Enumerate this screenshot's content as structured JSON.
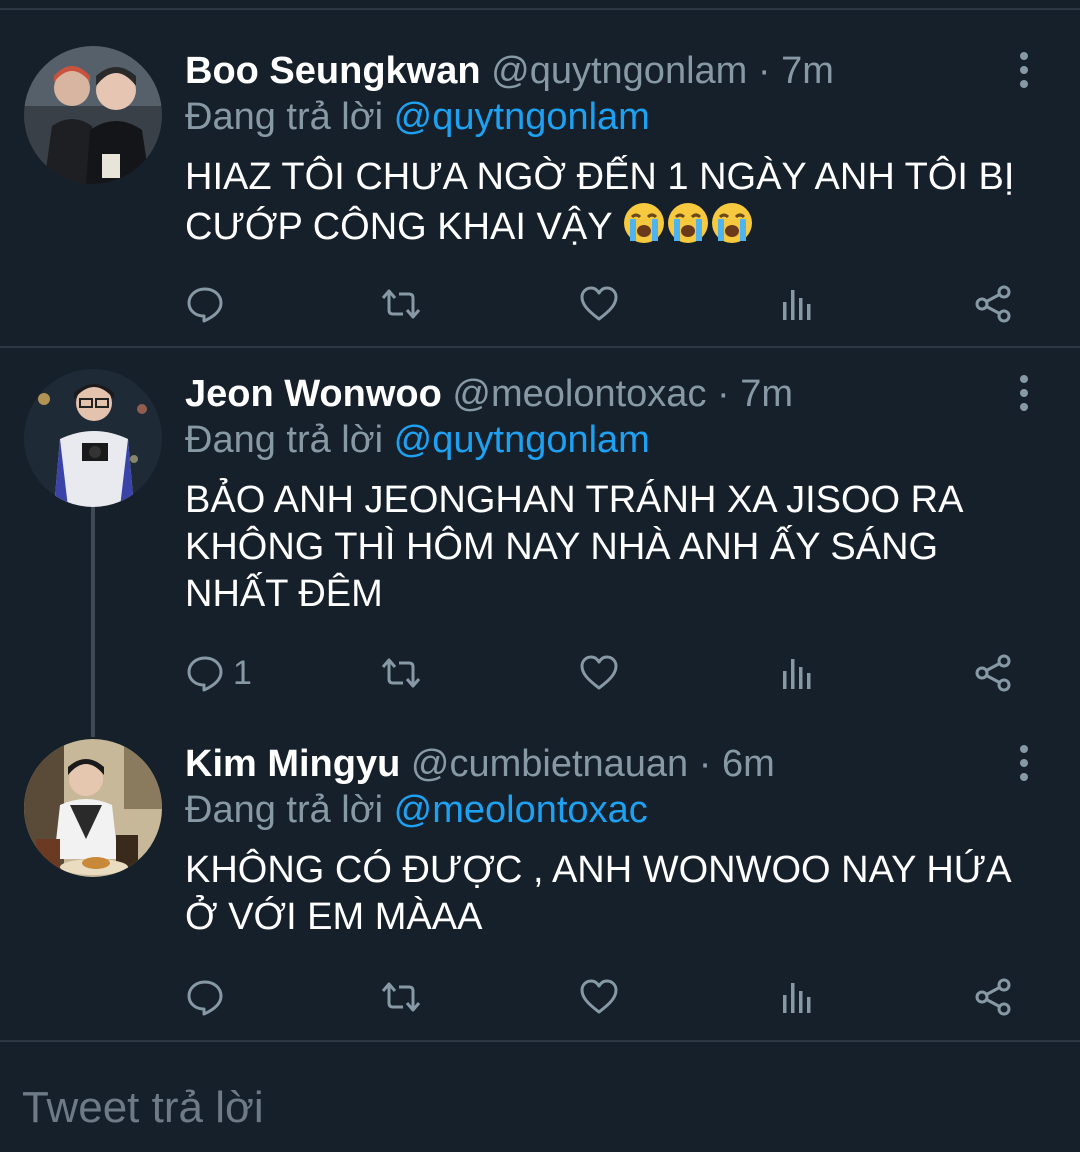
{
  "tweets": [
    {
      "name": "Boo Seungkwan",
      "handle": "@quytngonlam",
      "sep": "·",
      "time": "7m",
      "replying_label": "Đang trả lời",
      "replying_to": "@quytngonlam",
      "text": "HIAZ TÔI CHƯA NGỜ ĐẾN 1 NGÀY ANH TÔI BỊ CƯỚP CÔNG KHAI VẬY",
      "emojis": [
        "crying-face",
        "crying-face",
        "crying-face"
      ],
      "reply_count": ""
    },
    {
      "name": "Jeon Wonwoo",
      "handle": "@meolontoxac",
      "sep": "·",
      "time": "7m",
      "replying_label": "Đang trả lời",
      "replying_to": "@quytngonlam",
      "text": "BẢO ANH JEONGHAN TRÁNH XA JISOO RA KHÔNG THÌ HÔM NAY NHÀ ANH ẤY SÁNG NHẤT ĐÊM",
      "reply_count": "1"
    },
    {
      "name": "Kim Mingyu",
      "handle": "@cumbietnauan",
      "sep": "·",
      "time": "6m",
      "replying_label": "Đang trả lời",
      "replying_to": "@meolontoxac",
      "text": "KHÔNG CÓ ĐƯỢC , ANH WONWOO NAY HỨA Ở VỚI EM MÀAA",
      "reply_count": ""
    }
  ],
  "reply_box": {
    "placeholder": "Tweet trả lời"
  },
  "colors": {
    "background": "#15202b",
    "accent": "#1da1f2",
    "muted": "#8899a6"
  },
  "icons": [
    "reply-icon",
    "retweet-icon",
    "like-icon",
    "analytics-icon",
    "share-icon",
    "more-icon"
  ]
}
